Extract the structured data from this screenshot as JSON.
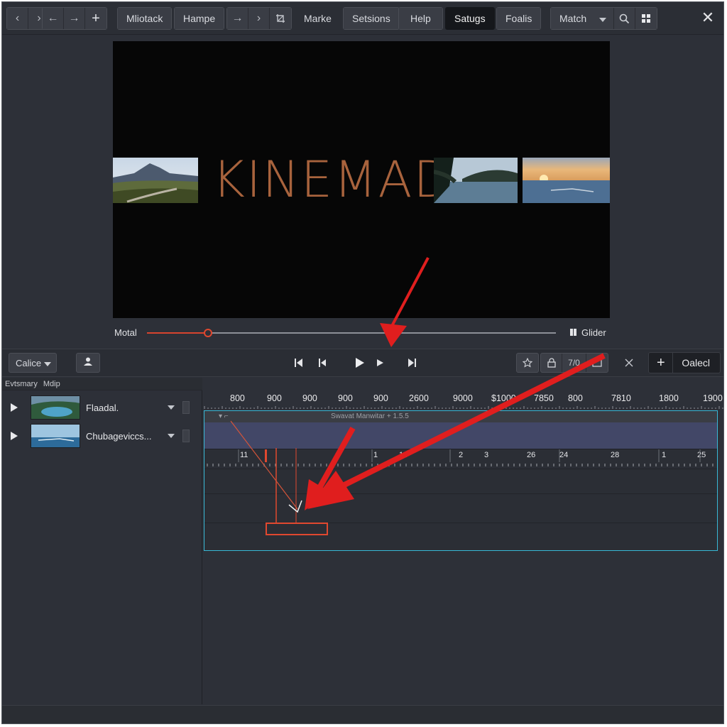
{
  "toolbar": {
    "nav_group_1": [
      "chevron-left-icon",
      "chevron-right-icon"
    ],
    "nav_group_2": [
      "arrow-left-icon",
      "arrow-right-icon",
      "plus-icon"
    ],
    "tab1": "Mliotack",
    "tab2": "Hampe",
    "nav_group_3": [
      "arrow-right-icon",
      "chevron-right-icon",
      "crop-icon"
    ],
    "menu": [
      "Marke",
      "Setsions",
      "Help",
      "Satugs",
      "Foalis"
    ],
    "active_menu": "Satugs",
    "match_label": "Match",
    "right_icons": [
      "search-icon",
      "grid-icon"
    ]
  },
  "viewer": {
    "title_text": "KINEMAD!"
  },
  "scrubber": {
    "left_label": "Motal",
    "right_label": "Glider",
    "position": 0.15
  },
  "transport": {
    "dropdown_label": "Calice",
    "right_button_label": "Oalecl",
    "time_label": "7/0"
  },
  "tracks_panel": {
    "breadcrumb_1": "Evtsmary",
    "breadcrumb_2": "Mdip",
    "tracks": [
      {
        "name": "Flaadal."
      },
      {
        "name": "Chubageviccs..."
      }
    ]
  },
  "timeline": {
    "ruler_labels": [
      "800",
      "900",
      "900",
      "900",
      "900",
      "2600",
      "9000",
      "$1000",
      "7850",
      "800",
      "7810",
      "1800",
      "1900"
    ],
    "track_strip_label": "Swavat Manwitar + 1.5.5",
    "sub_ruler_labels": [
      "11",
      "1",
      "14",
      "2",
      "3",
      "26",
      "24",
      "28",
      "1",
      "25"
    ]
  },
  "colors": {
    "accent": "#e0482f",
    "selection": "#38b8d6",
    "clip_band": "#424767",
    "title": "#a8633d"
  }
}
